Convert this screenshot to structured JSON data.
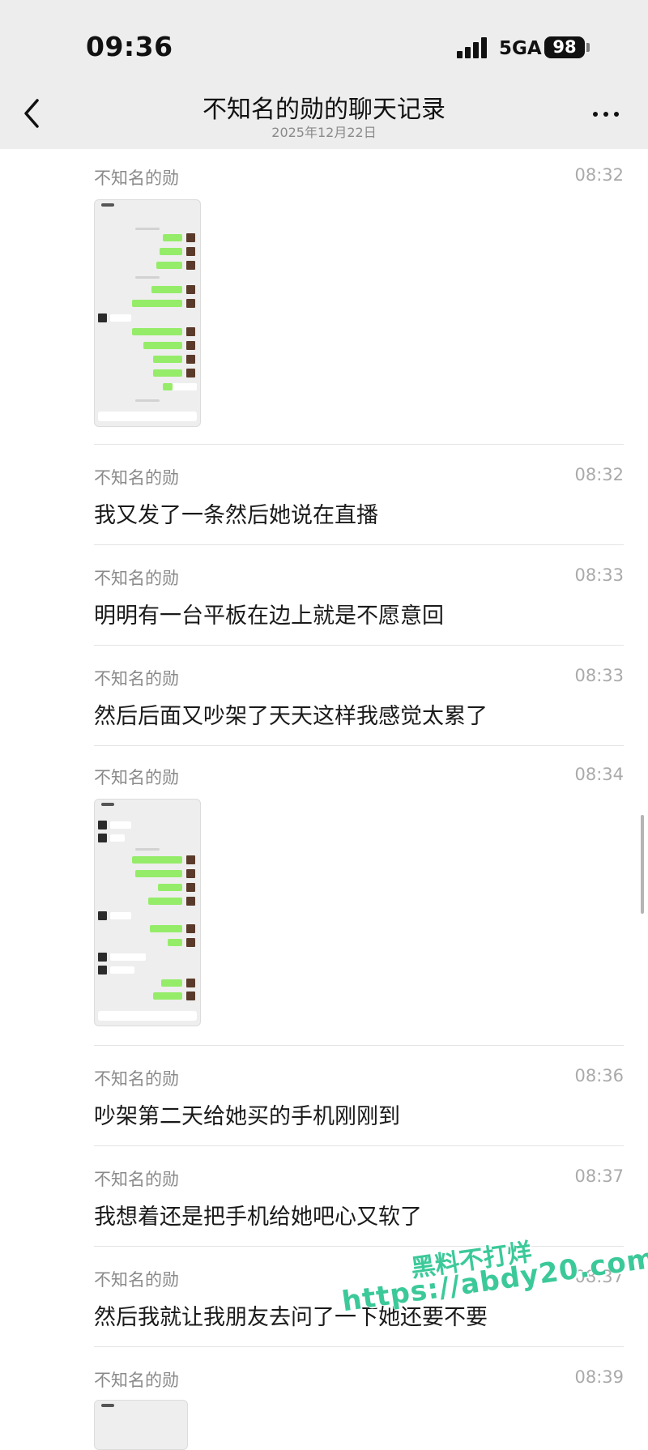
{
  "status_bar": {
    "time": "09:36",
    "network": "5GA",
    "battery": "98"
  },
  "nav": {
    "title": "不知名的勋的聊天记录",
    "subtitle": "2025年12月22日"
  },
  "messages": [
    {
      "sender": "不知名的勋",
      "time": "08:32",
      "type": "image"
    },
    {
      "sender": "不知名的勋",
      "time": "08:32",
      "type": "text",
      "text": "我又发了一条然后她说在直播"
    },
    {
      "sender": "不知名的勋",
      "time": "08:33",
      "type": "text",
      "text": "明明有一台平板在边上就是不愿意回"
    },
    {
      "sender": "不知名的勋",
      "time": "08:33",
      "type": "text",
      "text": "然后后面又吵架了天天这样我感觉太累了"
    },
    {
      "sender": "不知名的勋",
      "time": "08:34",
      "type": "image"
    },
    {
      "sender": "不知名的勋",
      "time": "08:36",
      "type": "text",
      "text": "吵架第二天给她买的手机刚刚到"
    },
    {
      "sender": "不知名的勋",
      "time": "08:37",
      "type": "text",
      "text": "我想着还是把手机给她吧心又软了"
    },
    {
      "sender": "不知名的勋",
      "time": "08:37",
      "type": "text",
      "text": "然后我就让我朋友去问了一下她还要不要"
    },
    {
      "sender": "不知名的勋",
      "time": "08:39",
      "type": "image"
    }
  ],
  "icons": {
    "back": "chevron-left-icon",
    "more": "more-dots-icon",
    "signal": "signal-icon",
    "battery": "battery-icon"
  },
  "colors": {
    "header_bg": "#ededed",
    "bubble_green": "#95ec69",
    "watermark": "#3cc99a"
  },
  "watermark": {
    "line1": "黑料不打烊",
    "line2": "https://abdy20.com"
  }
}
